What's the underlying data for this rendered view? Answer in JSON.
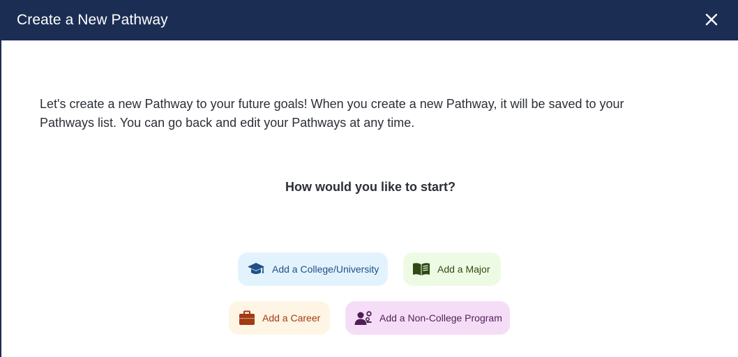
{
  "modal": {
    "title": "Create a New Pathway",
    "close_icon": "close-icon"
  },
  "intro": {
    "text": "Let's create a new Pathway to your future goals! When you create a new Pathway, it will be saved to your Pathways list. You can go back and edit your Pathways at any time."
  },
  "question": {
    "text": "How would you like to start?"
  },
  "options": [
    {
      "label": "Add a College/University",
      "icon": "graduation-cap-icon",
      "color": "#1e4f86",
      "background": "#e3f3fd"
    },
    {
      "label": "Add a Major",
      "icon": "book-icon",
      "color": "#2f4a14",
      "background": "#eefbe4"
    },
    {
      "label": "Add a Career",
      "icon": "briefcase-icon",
      "color": "#a23a14",
      "background": "#fff5e4"
    },
    {
      "label": "Add a Non-College Program",
      "icon": "person-gears-icon",
      "color": "#4e1f55",
      "background": "#f6ddf7"
    }
  ],
  "colors": {
    "header": "#1b2d52",
    "text": "#2b2f36"
  }
}
